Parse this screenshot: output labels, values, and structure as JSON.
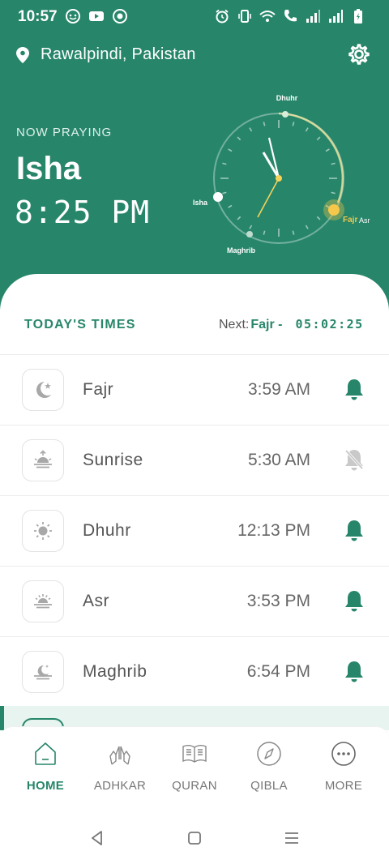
{
  "status_bar": {
    "time": "10:57"
  },
  "location": {
    "icon": "location-pin-icon",
    "name": "Rawalpindi, Pakistan"
  },
  "settings_icon": "gear-icon",
  "now": {
    "label": "NOW PRAYING",
    "prayer": "Isha",
    "time": "8:25 PM"
  },
  "clock": {
    "labels": {
      "dhuhr": "Dhuhr",
      "isha": "Isha",
      "maghrib": "Maghrib",
      "fajr": "Fajr",
      "asr": "Asr"
    }
  },
  "today": {
    "label": "TODAY'S TIMES",
    "next_label": "Next:",
    "next_prayer": "Fajr -",
    "countdown": "05:02:25"
  },
  "prayers": [
    {
      "name": "Fajr",
      "time": "3:59 AM",
      "icon": "moon-star-icon",
      "alarm": "on"
    },
    {
      "name": "Sunrise",
      "time": "5:30 AM",
      "icon": "sunrise-icon",
      "alarm": "off"
    },
    {
      "name": "Dhuhr",
      "time": "12:13 PM",
      "icon": "sun-icon",
      "alarm": "on"
    },
    {
      "name": "Asr",
      "time": "3:53 PM",
      "icon": "sun-horizon-icon",
      "alarm": "on"
    },
    {
      "name": "Maghrib",
      "time": "6:54 PM",
      "icon": "moon-horizon-icon",
      "alarm": "on"
    }
  ],
  "nav": [
    {
      "label": "HOME",
      "icon": "home-icon",
      "active": true
    },
    {
      "label": "ADHKAR",
      "icon": "praying-hands-icon",
      "active": false
    },
    {
      "label": "QURAN",
      "icon": "book-icon",
      "active": false
    },
    {
      "label": "QIBLA",
      "icon": "compass-icon",
      "active": false
    },
    {
      "label": "MORE",
      "icon": "more-icon",
      "active": false
    }
  ],
  "colors": {
    "primary": "#27866a",
    "accent": "#f5c74a",
    "active_row": "#e7f4ef"
  }
}
